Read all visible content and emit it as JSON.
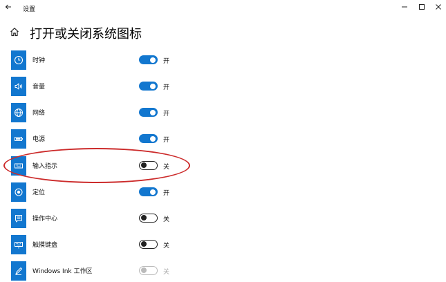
{
  "window": {
    "title": "设置",
    "back_icon": "back-arrow-icon",
    "controls": [
      "minimize-icon",
      "maximize-icon",
      "close-icon"
    ]
  },
  "page": {
    "title": "打开或关闭系统图标",
    "home_icon": "home-icon"
  },
  "colors": {
    "accent": "#1277cf",
    "highlight": "#cc2b2b"
  },
  "items": [
    {
      "label": "时钟",
      "icon": "clock-icon",
      "state": "开",
      "on": true
    },
    {
      "label": "音量",
      "icon": "volume-icon",
      "state": "开",
      "on": true
    },
    {
      "label": "网络",
      "icon": "network-globe-icon",
      "state": "开",
      "on": true
    },
    {
      "label": "电源",
      "icon": "battery-icon",
      "state": "开",
      "on": true
    },
    {
      "label": "输入指示",
      "icon": "keyboard-icon",
      "state": "关",
      "on": false
    },
    {
      "label": "定位",
      "icon": "location-icon",
      "state": "开",
      "on": true
    },
    {
      "label": "操作中心",
      "icon": "action-center-icon",
      "state": "关",
      "on": false
    },
    {
      "label": "触摸键盘",
      "icon": "touch-keyboard-icon",
      "state": "关",
      "on": false
    },
    {
      "label": "Windows Ink 工作区",
      "icon": "pen-icon",
      "state": "关",
      "on": false,
      "disabled": true
    }
  ]
}
